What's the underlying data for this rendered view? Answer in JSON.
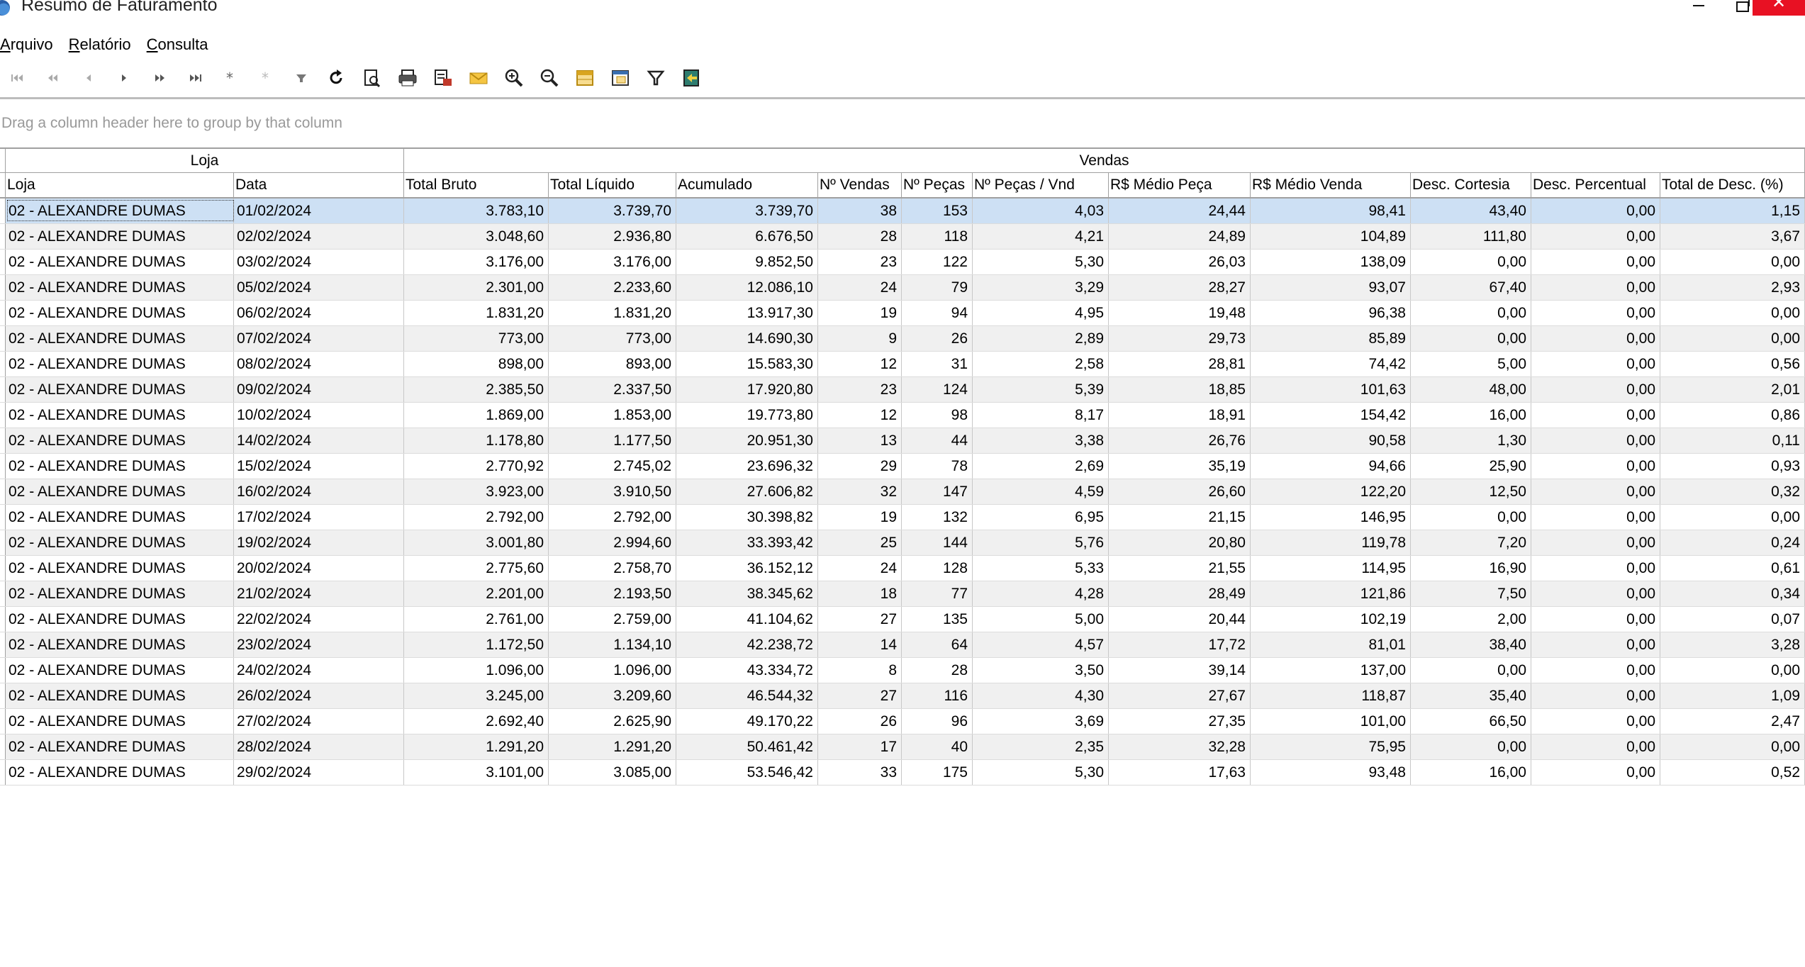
{
  "window": {
    "title": "Resumo de Faturamento",
    "minimize_glyph": "",
    "close_glyph": "✕"
  },
  "menu": [
    "Arquivo",
    "Relatório",
    "Consulta"
  ],
  "toolbar_icons": [
    "first-record-icon",
    "prior-page-icon",
    "prior-record-icon",
    "next-record-icon",
    "next-page-icon",
    "last-record-icon",
    "insert-record-icon",
    "delete-record-icon",
    "post-filter-icon",
    "refresh-icon",
    "print-preview-icon",
    "print-icon",
    "export-icon",
    "email-icon",
    "zoom-in-icon",
    "zoom-out-icon",
    "column-chooser-icon",
    "layout-icon",
    "filter-icon",
    "exit-icon"
  ],
  "group_panel": {
    "hint": "Drag a column header here to group by that column"
  },
  "grid": {
    "bands": [
      "Loja",
      "Vendas"
    ],
    "columns": [
      "Loja",
      "Data",
      "Total Bruto",
      "Total Líquido",
      "Acumulado",
      "Nº Vendas",
      "Nº Peças",
      "Nº Peças / Vnd",
      "R$ Médio Peça",
      "R$ Médio Venda",
      "Desc. Cortesia",
      "Desc. Percentual",
      "Total de Desc. (%)"
    ],
    "rows": [
      [
        "02 - ALEXANDRE DUMAS",
        "01/02/2024",
        "3.783,10",
        "3.739,70",
        "3.739,70",
        "38",
        "153",
        "4,03",
        "24,44",
        "98,41",
        "43,40",
        "0,00",
        "1,15"
      ],
      [
        "02 - ALEXANDRE DUMAS",
        "02/02/2024",
        "3.048,60",
        "2.936,80",
        "6.676,50",
        "28",
        "118",
        "4,21",
        "24,89",
        "104,89",
        "111,80",
        "0,00",
        "3,67"
      ],
      [
        "02 - ALEXANDRE DUMAS",
        "03/02/2024",
        "3.176,00",
        "3.176,00",
        "9.852,50",
        "23",
        "122",
        "5,30",
        "26,03",
        "138,09",
        "0,00",
        "0,00",
        "0,00"
      ],
      [
        "02 - ALEXANDRE DUMAS",
        "05/02/2024",
        "2.301,00",
        "2.233,60",
        "12.086,10",
        "24",
        "79",
        "3,29",
        "28,27",
        "93,07",
        "67,40",
        "0,00",
        "2,93"
      ],
      [
        "02 - ALEXANDRE DUMAS",
        "06/02/2024",
        "1.831,20",
        "1.831,20",
        "13.917,30",
        "19",
        "94",
        "4,95",
        "19,48",
        "96,38",
        "0,00",
        "0,00",
        "0,00"
      ],
      [
        "02 - ALEXANDRE DUMAS",
        "07/02/2024",
        "773,00",
        "773,00",
        "14.690,30",
        "9",
        "26",
        "2,89",
        "29,73",
        "85,89",
        "0,00",
        "0,00",
        "0,00"
      ],
      [
        "02 - ALEXANDRE DUMAS",
        "08/02/2024",
        "898,00",
        "893,00",
        "15.583,30",
        "12",
        "31",
        "2,58",
        "28,81",
        "74,42",
        "5,00",
        "0,00",
        "0,56"
      ],
      [
        "02 - ALEXANDRE DUMAS",
        "09/02/2024",
        "2.385,50",
        "2.337,50",
        "17.920,80",
        "23",
        "124",
        "5,39",
        "18,85",
        "101,63",
        "48,00",
        "0,00",
        "2,01"
      ],
      [
        "02 - ALEXANDRE DUMAS",
        "10/02/2024",
        "1.869,00",
        "1.853,00",
        "19.773,80",
        "12",
        "98",
        "8,17",
        "18,91",
        "154,42",
        "16,00",
        "0,00",
        "0,86"
      ],
      [
        "02 - ALEXANDRE DUMAS",
        "14/02/2024",
        "1.178,80",
        "1.177,50",
        "20.951,30",
        "13",
        "44",
        "3,38",
        "26,76",
        "90,58",
        "1,30",
        "0,00",
        "0,11"
      ],
      [
        "02 - ALEXANDRE DUMAS",
        "15/02/2024",
        "2.770,92",
        "2.745,02",
        "23.696,32",
        "29",
        "78",
        "2,69",
        "35,19",
        "94,66",
        "25,90",
        "0,00",
        "0,93"
      ],
      [
        "02 - ALEXANDRE DUMAS",
        "16/02/2024",
        "3.923,00",
        "3.910,50",
        "27.606,82",
        "32",
        "147",
        "4,59",
        "26,60",
        "122,20",
        "12,50",
        "0,00",
        "0,32"
      ],
      [
        "02 - ALEXANDRE DUMAS",
        "17/02/2024",
        "2.792,00",
        "2.792,00",
        "30.398,82",
        "19",
        "132",
        "6,95",
        "21,15",
        "146,95",
        "0,00",
        "0,00",
        "0,00"
      ],
      [
        "02 - ALEXANDRE DUMAS",
        "19/02/2024",
        "3.001,80",
        "2.994,60",
        "33.393,42",
        "25",
        "144",
        "5,76",
        "20,80",
        "119,78",
        "7,20",
        "0,00",
        "0,24"
      ],
      [
        "02 - ALEXANDRE DUMAS",
        "20/02/2024",
        "2.775,60",
        "2.758,70",
        "36.152,12",
        "24",
        "128",
        "5,33",
        "21,55",
        "114,95",
        "16,90",
        "0,00",
        "0,61"
      ],
      [
        "02 - ALEXANDRE DUMAS",
        "21/02/2024",
        "2.201,00",
        "2.193,50",
        "38.345,62",
        "18",
        "77",
        "4,28",
        "28,49",
        "121,86",
        "7,50",
        "0,00",
        "0,34"
      ],
      [
        "02 - ALEXANDRE DUMAS",
        "22/02/2024",
        "2.761,00",
        "2.759,00",
        "41.104,62",
        "27",
        "135",
        "5,00",
        "20,44",
        "102,19",
        "2,00",
        "0,00",
        "0,07"
      ],
      [
        "02 - ALEXANDRE DUMAS",
        "23/02/2024",
        "1.172,50",
        "1.134,10",
        "42.238,72",
        "14",
        "64",
        "4,57",
        "17,72",
        "81,01",
        "38,40",
        "0,00",
        "3,28"
      ],
      [
        "02 - ALEXANDRE DUMAS",
        "24/02/2024",
        "1.096,00",
        "1.096,00",
        "43.334,72",
        "8",
        "28",
        "3,50",
        "39,14",
        "137,00",
        "0,00",
        "0,00",
        "0,00"
      ],
      [
        "02 - ALEXANDRE DUMAS",
        "26/02/2024",
        "3.245,00",
        "3.209,60",
        "46.544,32",
        "27",
        "116",
        "4,30",
        "27,67",
        "118,87",
        "35,40",
        "0,00",
        "1,09"
      ],
      [
        "02 - ALEXANDRE DUMAS",
        "27/02/2024",
        "2.692,40",
        "2.625,90",
        "49.170,22",
        "26",
        "96",
        "3,69",
        "27,35",
        "101,00",
        "66,50",
        "0,00",
        "2,47"
      ],
      [
        "02 - ALEXANDRE DUMAS",
        "28/02/2024",
        "1.291,20",
        "1.291,20",
        "50.461,42",
        "17",
        "40",
        "2,35",
        "32,28",
        "75,95",
        "0,00",
        "0,00",
        "0,00"
      ],
      [
        "02 - ALEXANDRE DUMAS",
        "29/02/2024",
        "3.101,00",
        "3.085,00",
        "53.546,42",
        "33",
        "175",
        "5,30",
        "17,63",
        "93,48",
        "16,00",
        "0,00",
        "0,52"
      ]
    ],
    "selected_row": 0
  }
}
